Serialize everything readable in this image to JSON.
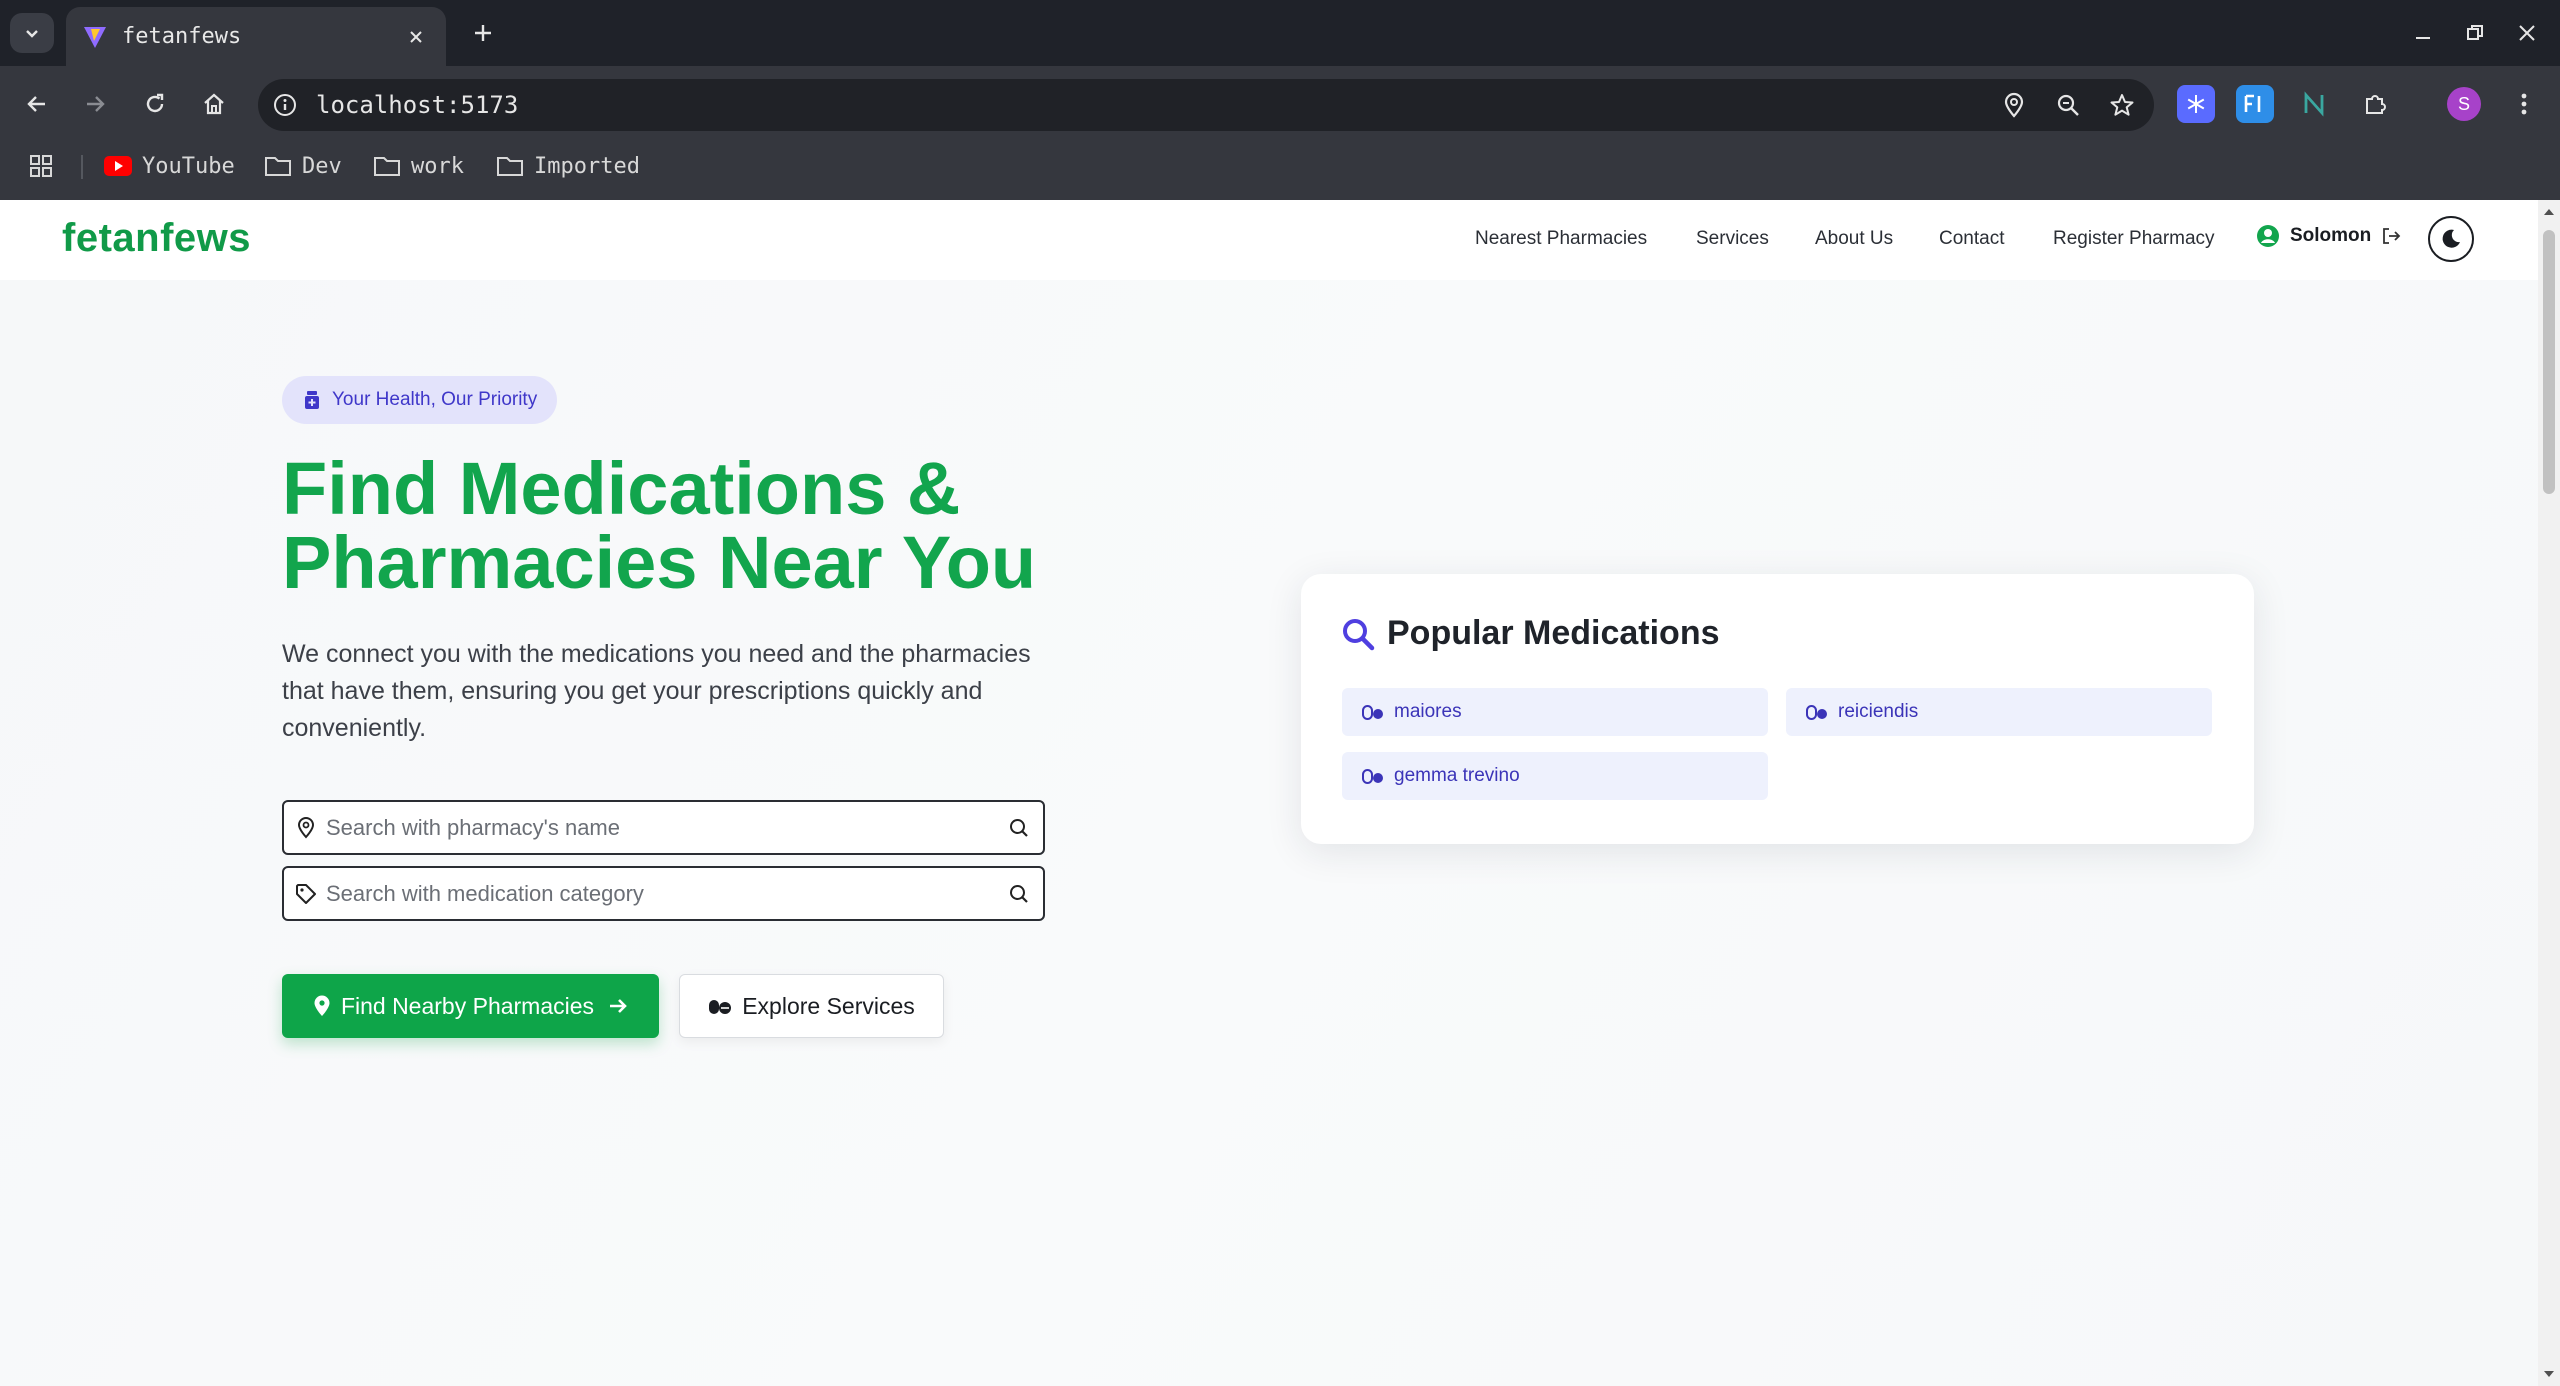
{
  "browser": {
    "tab_title": "fetanfews",
    "url": "localhost:5173",
    "profile_initial": "S",
    "bookmarks": [
      "YouTube",
      "Dev",
      "work",
      "Imported"
    ]
  },
  "navbar": {
    "brand": "fetanfews",
    "links": [
      "Nearest Pharmacies",
      "Services",
      "About Us",
      "Contact",
      "Register Pharmacy"
    ],
    "user_name": "Solomon"
  },
  "hero": {
    "badge": "Your Health, Our Priority",
    "title_line1": "Find Medications &",
    "title_line2": "Pharmacies Near You",
    "description": "We connect you with the medications you need and the pharmacies that have them, ensuring you get your prescriptions quickly and conveniently.",
    "search_pharmacy_placeholder": "Search with pharmacy's name",
    "search_category_placeholder": "Search with medication category",
    "primary_button": "Find Nearby Pharmacies",
    "secondary_button": "Explore Services"
  },
  "popular": {
    "title": "Popular Medications",
    "items": [
      "maiores",
      "reiciendis",
      "gemma trevino"
    ]
  },
  "colors": {
    "brand_green": "#109a48",
    "button_green": "#0ea549",
    "accent_indigo": "#3f37c9",
    "chip_bg": "#eef1fd"
  }
}
